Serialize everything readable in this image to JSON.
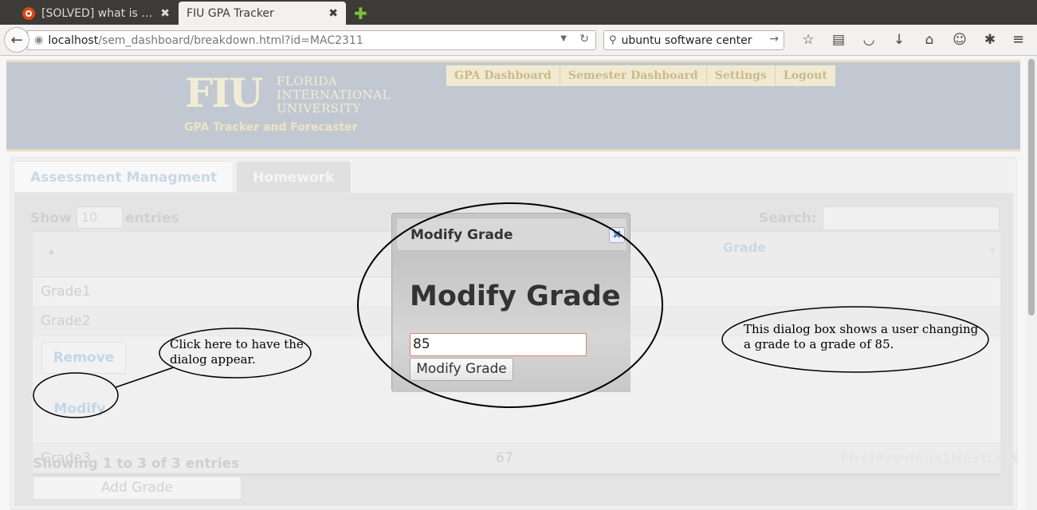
{
  "browser": {
    "tabs": [
      {
        "label": "[SOLVED] what is eq…",
        "close": "✖"
      },
      {
        "label": "FIU GPA Tracker",
        "close": "✖"
      }
    ],
    "new_tab": "✚",
    "url_host": "localhost",
    "url_path": "/sem_dashboard/breakdown.html?id=MAC2311",
    "search_text": "ubuntu software center"
  },
  "header": {
    "logo": "FIU",
    "logo_lines": [
      "FLORIDA",
      "INTERNATIONAL",
      "UNIVERSITY"
    ],
    "tagline": "GPA Tracker and Forecaster",
    "nav": [
      "GPA Dashboard",
      "Semester Dashboard",
      "Settings",
      "Logout"
    ]
  },
  "tabs": [
    "Assessment Managment",
    "Homework"
  ],
  "table_controls": {
    "show_label": "Show",
    "show_value": "10",
    "entries_label": "entries",
    "search_label": "Search:"
  },
  "table": {
    "grade_header": "Grade",
    "rows": [
      {
        "name": "Grade1",
        "grade": ""
      },
      {
        "name": "Grade2",
        "grade": ""
      },
      {
        "name": "Grade3",
        "grade": "67"
      }
    ],
    "remove_label": "Remove",
    "modify_label": "Modify",
    "info": "Showing 1 to 3 of 3 entries",
    "paginate": "FirstPrevious1NextLast",
    "add_label": "Add Grade"
  },
  "dialog": {
    "title": "Modify Grade",
    "heading": "Modify Grade",
    "input_value": "85",
    "button": "Modify Grade"
  },
  "annotations": {
    "click_note": [
      "Click here to have the",
      "dialog appear."
    ],
    "dialog_note": [
      "This dialog box shows a user changing",
      "a grade to a grade of 85."
    ]
  }
}
